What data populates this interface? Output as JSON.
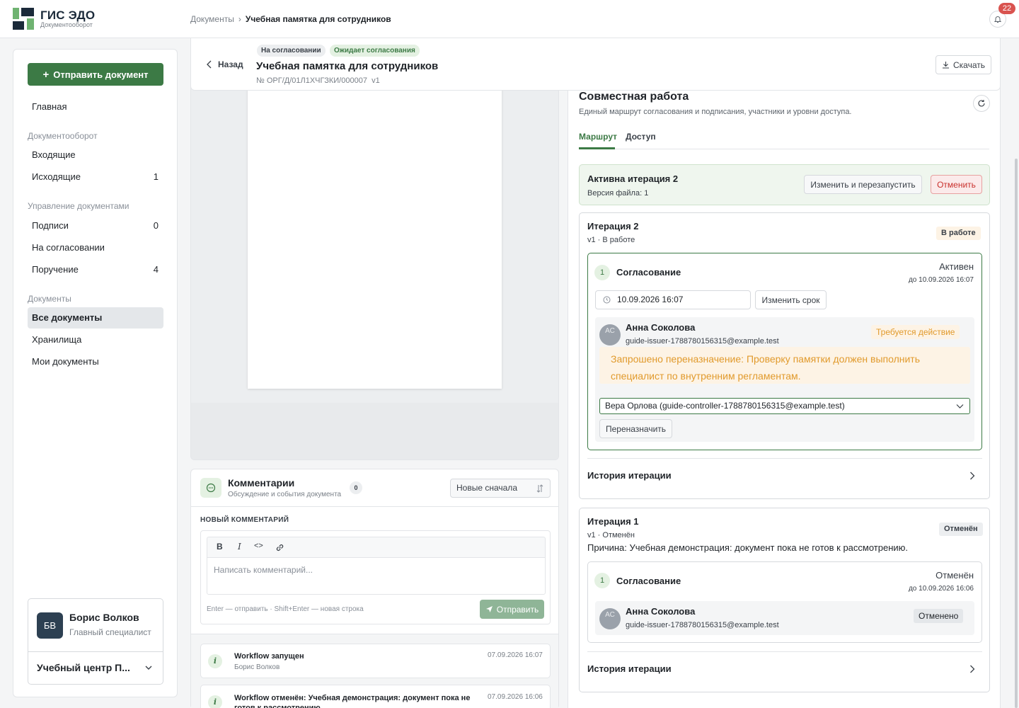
{
  "app": {
    "title": "ГИС ЭДО",
    "subtitle": "Документооборот",
    "notifications_count": "22",
    "colors": {
      "accent": "#3c7a45",
      "logo_dark": "#1b2a3a",
      "logo_green": "#6fb371",
      "danger": "#d9534f",
      "warning": "#e19a2c"
    }
  },
  "breadcrumb": {
    "root": "Документы",
    "separator": "›",
    "current": "Учебная памятка для сотрудников"
  },
  "sidebar": {
    "send_button": "Отправить документ",
    "home": "Главная",
    "sections": [
      {
        "title": "Документооборот",
        "items": [
          {
            "label": "Входящие",
            "count": ""
          },
          {
            "label": "Исходящие",
            "count": "1"
          }
        ]
      },
      {
        "title": "Управление документами",
        "items": [
          {
            "label": "Подписи",
            "count": "0"
          },
          {
            "label": "На согласовании",
            "count": ""
          },
          {
            "label": "Поручение",
            "count": "4"
          }
        ]
      },
      {
        "title": "Документы",
        "items": [
          {
            "label": "Все документы",
            "count": "",
            "active": true
          },
          {
            "label": "Хранилища",
            "count": ""
          },
          {
            "label": "Мои документы",
            "count": ""
          }
        ]
      }
    ],
    "user": {
      "initials": "БВ",
      "name": "Борис Волков",
      "role": "Главный специалист",
      "org": "Учебный центр П..."
    }
  },
  "document": {
    "back": "Назад",
    "badges": [
      "На согласовании",
      "Ожидает согласования"
    ],
    "title": "Учебная памятка для сотрудников",
    "number": "№ ОРГ/Д/01Л1ХЧГЗКИ/000007",
    "version": "v1",
    "download": "Скачать"
  },
  "comments": {
    "title": "Комментарии",
    "subtitle": "Обсуждение и события документа",
    "count": "0",
    "sort": "Новые сначала",
    "new_label": "НОВЫЙ КОММЕНТАРИЙ",
    "toolbar": {
      "bold": "B",
      "italic": "I",
      "code": "<>"
    },
    "placeholder": "Написать комментарий...",
    "hint": "Enter — отправить · Shift+Enter — новая строка",
    "submit": "Отправить",
    "events": [
      {
        "title": "Workflow запущен",
        "author": "Борис Волков",
        "date": "07.09.2026 16:07"
      },
      {
        "title": "Workflow отменён: Учебная демонстрация: документ пока не готов к рассмотрению.",
        "author": "",
        "date": "07.09.2026 16:06"
      }
    ]
  },
  "collab": {
    "title": "Совместная работа",
    "subtitle": "Единый маршрут согласования и подписания, участники и уровни доступа.",
    "tabs": [
      "Маршрут",
      "Доступ"
    ],
    "active_iteration": {
      "title": "Активна итерация 2",
      "file_version": "Версия файла: 1",
      "restart": "Изменить и перезапустить",
      "cancel": "Отменить"
    },
    "iteration2": {
      "title": "Итерация 2",
      "sub": "v1 · В работе",
      "badge": "В работе",
      "stage": {
        "num": "1",
        "title": "Согласование",
        "status": "Активен",
        "due": "до 10.09.2026 16:07",
        "date_value": "10.09.2026 16:07",
        "change_due": "Изменить срок",
        "participant": {
          "initials": "АС",
          "name": "Анна Соколова",
          "email": "guide-issuer-1788780156315@example.test",
          "badge": "Требуется действие",
          "note": "Запрошено переназначение: Проверку памятки должен выполнить специалист по внутренним регламентам.",
          "reassign_to": "Вера Орлова (guide-controller-1788780156315@example.test)",
          "reassign_button": "Переназначить"
        }
      },
      "history": "История итерации"
    },
    "iteration1": {
      "title": "Итерация 1",
      "sub": "v1 · Отменён",
      "badge": "Отменён",
      "reason": "Причина: Учебная демонстрация: документ пока не готов к рассмотрению.",
      "stage": {
        "num": "1",
        "title": "Согласование",
        "status": "Отменён",
        "due": "до 10.09.2026 16:06",
        "participant": {
          "initials": "АС",
          "name": "Анна Соколова",
          "email": "guide-issuer-1788780156315@example.test",
          "badge": "Отменено"
        }
      },
      "history": "История итерации"
    }
  }
}
